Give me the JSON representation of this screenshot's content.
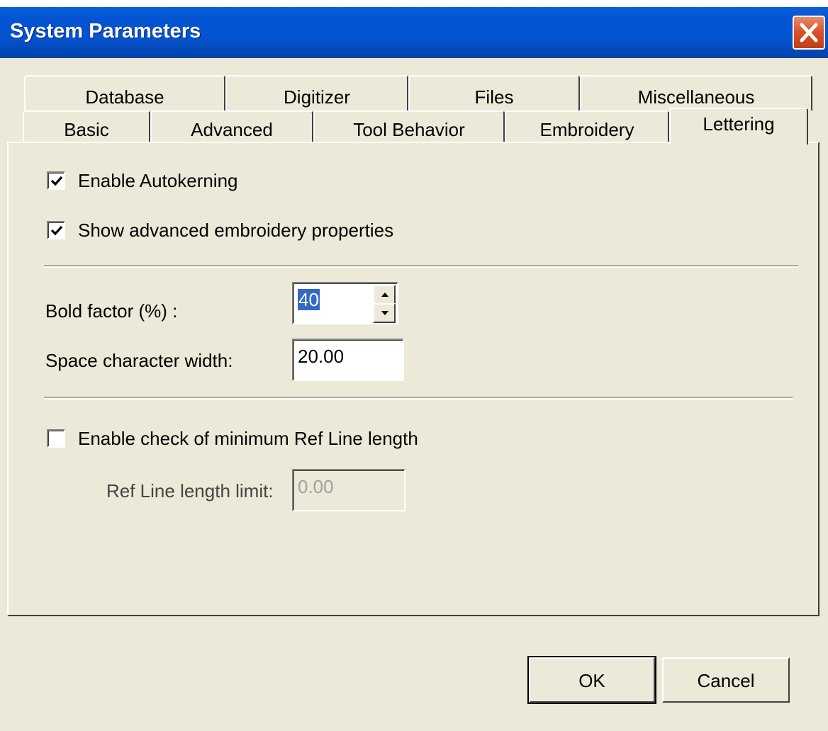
{
  "window": {
    "title": "System Parameters",
    "close_icon": "close-icon"
  },
  "tabs": {
    "row1": [
      "Database",
      "Digitizer",
      "Files",
      "Miscellaneous"
    ],
    "row2": [
      "Basic",
      "Advanced",
      "Tool Behavior",
      "Embroidery",
      "Lettering"
    ],
    "active": "Lettering"
  },
  "lettering": {
    "autokerning": {
      "label": "Enable Autokerning",
      "checked": true
    },
    "advanced_props": {
      "label": "Show advanced embroidery properties",
      "checked": true
    },
    "bold_factor": {
      "label": "Bold factor (%) :",
      "value": "40"
    },
    "space_width": {
      "label": "Space character width:",
      "value": "20.00"
    },
    "ref_line_check": {
      "label": "Enable check of minimum Ref Line length",
      "checked": false
    },
    "ref_line_limit": {
      "label": "Ref Line length limit:",
      "value": "0.00"
    }
  },
  "buttons": {
    "ok": "OK",
    "cancel": "Cancel"
  },
  "colors": {
    "titlebar": "#0453d2",
    "dialog_bg": "#ece9d8",
    "selection": "#316ac5",
    "close_button": "#d9502a"
  }
}
